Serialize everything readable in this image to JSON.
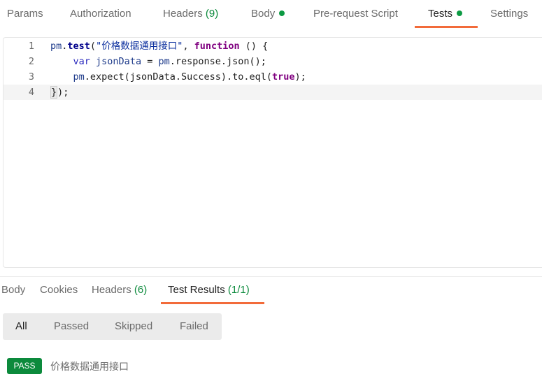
{
  "request_tabs": [
    {
      "label": "Params"
    },
    {
      "label": "Authorization"
    },
    {
      "label": "Headers",
      "count": "(9)"
    },
    {
      "label": "Body"
    },
    {
      "label": "Pre-request Script"
    },
    {
      "label": "Tests"
    },
    {
      "label": "Settings"
    }
  ],
  "editor": {
    "line_numbers": [
      "1",
      "2",
      "3",
      "4"
    ],
    "line1": {
      "pm": "pm",
      "dot": ".",
      "fn": "test",
      "open": "(",
      "str": "\"价格数据通用接口\"",
      "sep": ", ",
      "kw": "function",
      "rest": " () {"
    },
    "line2": {
      "indent": "    ",
      "kw": "var",
      "sp": " ",
      "name": "jsonData",
      "eq": " = ",
      "obj": "pm",
      "rest": ".response.json();"
    },
    "line3": {
      "indent": "    ",
      "obj": "pm",
      "mid": ".expect(jsonData.Success).to.eql(",
      "kw": "true",
      "end": ");"
    },
    "line4": {
      "brace": "}",
      "end": ");"
    }
  },
  "response_tabs": [
    {
      "label": "Body"
    },
    {
      "label": "Cookies"
    },
    {
      "label": "Headers",
      "count": "(6)"
    },
    {
      "label": "Test Results",
      "count": "(1/1)"
    }
  ],
  "filters": [
    "All",
    "Passed",
    "Skipped",
    "Failed"
  ],
  "results": [
    {
      "status": "PASS",
      "name": "价格数据通用接口"
    }
  ],
  "colors": {
    "accent": "#f26b3a",
    "success": "#0c8a3c",
    "indicator": "#0c9a43"
  }
}
